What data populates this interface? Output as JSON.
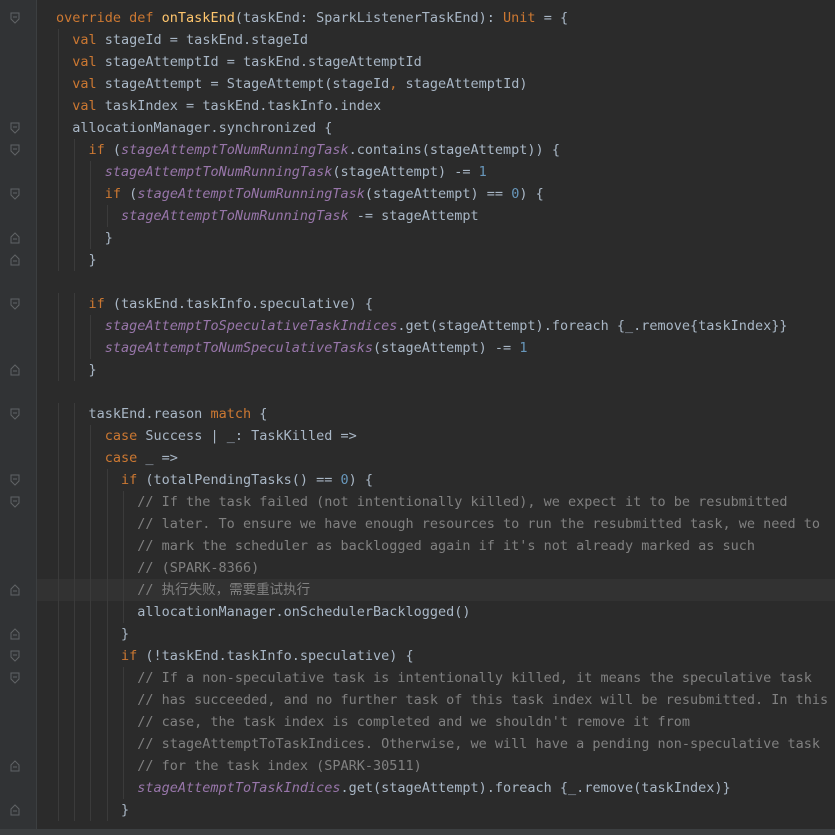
{
  "editor": {
    "lines": [
      {
        "indent": 0,
        "fold": "open",
        "tokens": [
          [
            "kw",
            "override def "
          ],
          [
            "fn",
            "onTaskEnd"
          ],
          [
            "",
            "(taskEnd: SparkListenerTaskEnd): "
          ],
          [
            "kw",
            "Unit"
          ],
          [
            "",
            " = {"
          ]
        ]
      },
      {
        "indent": 1,
        "fold": "",
        "tokens": [
          [
            "kw",
            "val "
          ],
          [
            "",
            "stageId = taskEnd.stageId"
          ]
        ]
      },
      {
        "indent": 1,
        "fold": "",
        "tokens": [
          [
            "kw",
            "val "
          ],
          [
            "",
            "stageAttemptId = taskEnd.stageAttemptId"
          ]
        ]
      },
      {
        "indent": 1,
        "fold": "",
        "tokens": [
          [
            "kw",
            "val "
          ],
          [
            "",
            "stageAttempt = StageAttempt(stageId"
          ],
          [
            "kw",
            ", "
          ],
          [
            "",
            "stageAttemptId)"
          ]
        ]
      },
      {
        "indent": 1,
        "fold": "",
        "tokens": [
          [
            "kw",
            "val "
          ],
          [
            "",
            "taskIndex = taskEnd.taskInfo.index"
          ]
        ]
      },
      {
        "indent": 1,
        "fold": "open",
        "tokens": [
          [
            "",
            "allocationManager.synchronized {"
          ]
        ]
      },
      {
        "indent": 2,
        "fold": "open",
        "tokens": [
          [
            "kw",
            "if "
          ],
          [
            "",
            "("
          ],
          [
            "field",
            "stageAttemptToNumRunningTask"
          ],
          [
            "",
            ".contains(stageAttempt)) {"
          ]
        ]
      },
      {
        "indent": 3,
        "fold": "",
        "tokens": [
          [
            "field",
            "stageAttemptToNumRunningTask"
          ],
          [
            "",
            "(stageAttempt) -= "
          ],
          [
            "num",
            "1"
          ]
        ]
      },
      {
        "indent": 3,
        "fold": "open",
        "tokens": [
          [
            "kw",
            "if "
          ],
          [
            "",
            "("
          ],
          [
            "field",
            "stageAttemptToNumRunningTask"
          ],
          [
            "",
            "(stageAttempt) == "
          ],
          [
            "num",
            "0"
          ],
          [
            "",
            ") {"
          ]
        ]
      },
      {
        "indent": 4,
        "fold": "",
        "tokens": [
          [
            "field",
            "stageAttemptToNumRunningTask"
          ],
          [
            "",
            " -= stageAttempt"
          ]
        ]
      },
      {
        "indent": 3,
        "fold": "close",
        "tokens": [
          [
            "",
            "}"
          ]
        ]
      },
      {
        "indent": 2,
        "fold": "close",
        "tokens": [
          [
            "",
            "}"
          ]
        ]
      },
      {
        "indent": 0,
        "fold": "",
        "tokens": []
      },
      {
        "indent": 2,
        "fold": "open",
        "tokens": [
          [
            "kw",
            "if "
          ],
          [
            "",
            "(taskEnd.taskInfo.speculative) {"
          ]
        ]
      },
      {
        "indent": 3,
        "fold": "",
        "tokens": [
          [
            "field",
            "stageAttemptToSpeculativeTaskIndices"
          ],
          [
            "",
            ".get(stageAttempt).foreach {_.remove{taskIndex}}"
          ]
        ]
      },
      {
        "indent": 3,
        "fold": "",
        "tokens": [
          [
            "field",
            "stageAttemptToNumSpeculativeTasks"
          ],
          [
            "",
            "(stageAttempt) -= "
          ],
          [
            "num",
            "1"
          ]
        ]
      },
      {
        "indent": 2,
        "fold": "close",
        "tokens": [
          [
            "",
            "}"
          ]
        ]
      },
      {
        "indent": 0,
        "fold": "",
        "tokens": []
      },
      {
        "indent": 2,
        "fold": "open",
        "tokens": [
          [
            "",
            "taskEnd.reason "
          ],
          [
            "kw",
            "match "
          ],
          [
            "",
            "{"
          ]
        ]
      },
      {
        "indent": 3,
        "fold": "",
        "tokens": [
          [
            "kw",
            "case "
          ],
          [
            "",
            "Success | _: TaskKilled =>"
          ]
        ]
      },
      {
        "indent": 3,
        "fold": "",
        "tokens": [
          [
            "kw",
            "case "
          ],
          [
            "",
            "_ =>"
          ]
        ]
      },
      {
        "indent": 4,
        "fold": "open",
        "tokens": [
          [
            "kw",
            "if "
          ],
          [
            "",
            "(totalPendingTasks() == "
          ],
          [
            "num",
            "0"
          ],
          [
            "",
            ") {"
          ]
        ]
      },
      {
        "indent": 5,
        "fold": "open",
        "tokens": [
          [
            "cm",
            "// If the task failed (not intentionally killed), we expect it to be resubmitted"
          ]
        ]
      },
      {
        "indent": 5,
        "fold": "",
        "tokens": [
          [
            "cm",
            "// later. To ensure we have enough resources to run the resubmitted task, we need to"
          ]
        ]
      },
      {
        "indent": 5,
        "fold": "",
        "tokens": [
          [
            "cm",
            "// mark the scheduler as backlogged again if it's not already marked as such"
          ]
        ]
      },
      {
        "indent": 5,
        "fold": "",
        "tokens": [
          [
            "cm",
            "// (SPARK-8366)"
          ]
        ]
      },
      {
        "indent": 5,
        "fold": "close",
        "hl": true,
        "tokens": [
          [
            "cm",
            "// 执行失败，需要重试执行"
          ]
        ]
      },
      {
        "indent": 5,
        "fold": "",
        "tokens": [
          [
            "",
            "allocationManager.onSchedulerBacklogged()"
          ]
        ]
      },
      {
        "indent": 4,
        "fold": "close",
        "tokens": [
          [
            "",
            "}"
          ]
        ]
      },
      {
        "indent": 4,
        "fold": "open",
        "tokens": [
          [
            "kw",
            "if "
          ],
          [
            "",
            "(!taskEnd.taskInfo.speculative) {"
          ]
        ]
      },
      {
        "indent": 5,
        "fold": "open",
        "tokens": [
          [
            "cm",
            "// If a non-speculative task is intentionally killed, it means the speculative task"
          ]
        ]
      },
      {
        "indent": 5,
        "fold": "",
        "tokens": [
          [
            "cm",
            "// has succeeded, and no further task of this task index will be resubmitted. In this"
          ]
        ]
      },
      {
        "indent": 5,
        "fold": "",
        "tokens": [
          [
            "cm",
            "// case, the task index is completed and we shouldn't remove it from"
          ]
        ]
      },
      {
        "indent": 5,
        "fold": "",
        "tokens": [
          [
            "cm",
            "// stageAttemptToTaskIndices. Otherwise, we will have a pending non-speculative task"
          ]
        ]
      },
      {
        "indent": 5,
        "fold": "close",
        "tokens": [
          [
            "cm",
            "// for the task index (SPARK-30511)"
          ]
        ]
      },
      {
        "indent": 5,
        "fold": "",
        "tokens": [
          [
            "field",
            "stageAttemptToTaskIndices"
          ],
          [
            "",
            ".get(stageAttempt).foreach {_.remove(taskIndex)}"
          ]
        ]
      },
      {
        "indent": 4,
        "fold": "close",
        "tokens": [
          [
            "",
            "}"
          ]
        ]
      }
    ]
  },
  "colors": {
    "background": "#2b2b2b",
    "keyword": "#cc7832",
    "function": "#ffc66d",
    "field": "#9876aa",
    "number": "#6897bb",
    "comment": "#808080"
  }
}
